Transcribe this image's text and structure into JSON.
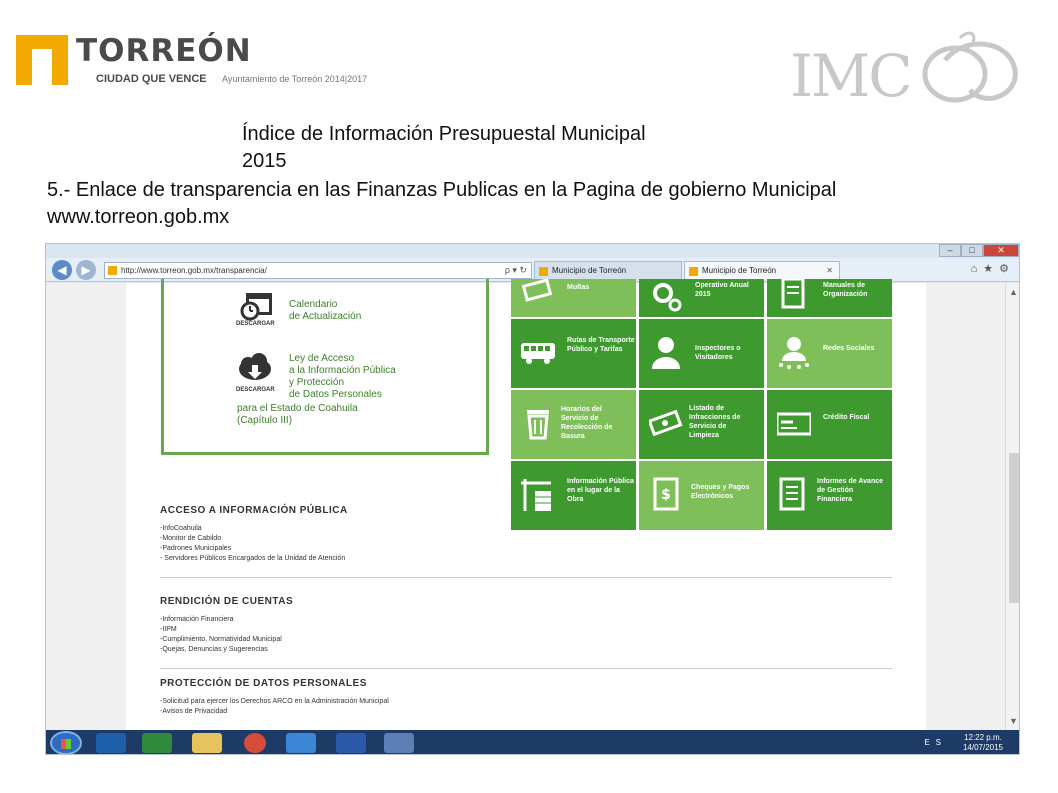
{
  "logos": {
    "torreon_name": "TORREÓN",
    "torreon_tagline": "CIUDAD QUE VENCE",
    "torreon_subtitle": "Ayuntamiento de Torreón 2014|2017",
    "imco_text": "IMC"
  },
  "slide": {
    "title_line1": "Índice de Información Presupuestal Municipal",
    "title_line2": "2015",
    "subtitle_line1": "5.- Enlace de transparencia en las Finanzas Publicas en la Pagina de gobierno Municipal",
    "subtitle_line2": "www.torreon.gob.mx"
  },
  "browser": {
    "address": "http://www.torreon.gob.mx/transparencia/",
    "address_controls": "ρ ▾ ↻",
    "tabs": [
      {
        "label": "Municipio de Torreón"
      },
      {
        "label": "Municipio de Torreón",
        "close": "✕"
      }
    ],
    "window_buttons": {
      "minimize": "–",
      "maximize": "□",
      "close": "✕"
    },
    "toolbar_icons": "⌂★⚙"
  },
  "page": {
    "downloads": [
      {
        "label_lines": [
          "Calendario",
          "de Actualización"
        ],
        "caption": "DESCARGAR",
        "icon": "calendar-icon"
      },
      {
        "label_lines": [
          "Ley de Acceso",
          "a la Información Pública",
          "y Protección",
          "de Datos Personales",
          "para el Estado de Coahuila",
          "(Capítulo III)"
        ],
        "caption": "DESCARGAR",
        "icon": "cloud-download-icon"
      }
    ],
    "tiles": [
      {
        "label": "Multas",
        "shade": "light",
        "icon": "money-icon"
      },
      {
        "label": "Operativo Anual 2015",
        "shade": "dark",
        "icon": "gears-icon"
      },
      {
        "label": "Manuales de Organización",
        "shade": "dark",
        "icon": "manual-icon"
      },
      {
        "label": "Rutas de Transporte Público y Tarifas",
        "shade": "dark",
        "icon": "bus-icon"
      },
      {
        "label": "Inspectores o Visitadores",
        "shade": "dark",
        "icon": "person-icon"
      },
      {
        "label": "Redes Sociales",
        "shade": "light",
        "icon": "network-icon"
      },
      {
        "label": "Horarios del Servicio de Recolección de Basura",
        "shade": "light",
        "icon": "trash-icon"
      },
      {
        "label": "Listado de Infracciones de Servicio de Limpieza",
        "shade": "dark",
        "icon": "money-icon"
      },
      {
        "label": "Crédito Fiscal",
        "shade": "dark",
        "icon": "card-icon"
      },
      {
        "label": "Información Pública en el lugar de la Obra",
        "shade": "dark",
        "icon": "crane-icon"
      },
      {
        "label": "Cheques y Pagos Electrónicos",
        "shade": "light",
        "icon": "cheque-icon"
      },
      {
        "label": "Informes de Avance de Gestión Financiera",
        "shade": "dark",
        "icon": "report-icon"
      }
    ],
    "sections": [
      {
        "title": "ACCESO A INFORMACIÓN PÚBLICA",
        "items": [
          "-InfoCoahuila",
          "-Monitor de Cabildo",
          "-Padrones Municipales",
          "- Servidores Públicos Encargados de la Unidad de Atención"
        ]
      },
      {
        "title": "RENDICIÓN DE CUENTAS",
        "items": [
          "-Información Financiera",
          "-IIPM",
          "-Cumplimiento, Normatividad Municipal",
          "-Quejas, Denuncias y Sugerencias"
        ]
      },
      {
        "title": "PROTECCIÓN DE DATOS PERSONALES",
        "items": [
          "-Solicitud para ejercer los Derechos ARCO en la Administración Municipal",
          "-Avisos de Privacidad"
        ]
      }
    ]
  },
  "taskbar": {
    "language": "ES",
    "time": "12:22 p.m.",
    "date": "14/07/2015"
  }
}
